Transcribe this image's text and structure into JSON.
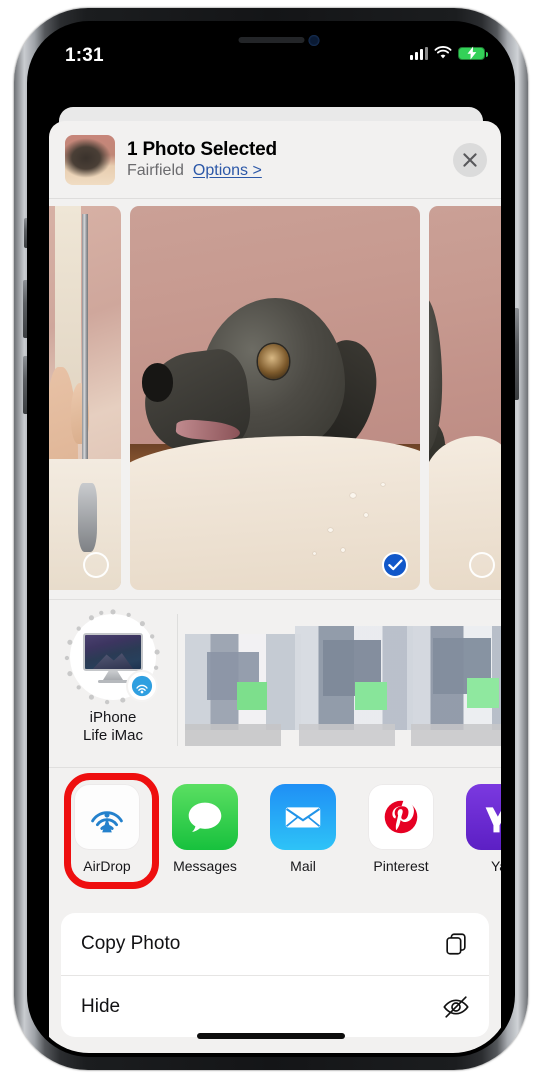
{
  "status_bar": {
    "time": "1:31",
    "signal_icon": "cellular-bars-icon",
    "wifi_icon": "wifi-icon",
    "battery_icon": "battery-charging-icon",
    "battery_color": "#33d158"
  },
  "share_sheet": {
    "header": {
      "thumbnail_name": "selected-photo-thumbnail",
      "title": "1 Photo Selected",
      "album": "Fairfield",
      "options_label": "Options >",
      "options_color": "#2c58a8",
      "close_icon": "close-icon"
    },
    "photos": [
      {
        "name": "photo-previous",
        "selected": false,
        "badge": "unselected-circle-icon"
      },
      {
        "name": "photo-current",
        "selected": true,
        "badge": "checkmark-circle-icon"
      },
      {
        "name": "photo-next",
        "selected": false,
        "badge": "unselected-circle-icon"
      }
    ],
    "selected_badge_color": "#1157c9",
    "airdrop": {
      "devices": [
        {
          "name": "iphone-life-imac",
          "label_line1": "iPhone",
          "label_line2": "Life iMac",
          "icon": "imac-icon",
          "badge_icon": "airdrop-badge-icon"
        }
      ],
      "blurred_suggestions_count": 4,
      "blurred_note": "pixelated contact suggestions"
    },
    "apps": [
      {
        "name": "airdrop",
        "label": "AirDrop",
        "icon": "airdrop-icon",
        "highlighted": true
      },
      {
        "name": "messages",
        "label": "Messages",
        "icon": "messages-icon",
        "highlighted": false
      },
      {
        "name": "mail",
        "label": "Mail",
        "icon": "mail-icon",
        "highlighted": false
      },
      {
        "name": "pinterest",
        "label": "Pinterest",
        "icon": "pinterest-icon",
        "highlighted": false
      },
      {
        "name": "yahoo",
        "label": "Ya",
        "icon": "yahoo-icon",
        "highlighted": false
      }
    ],
    "highlight_color": "#ee0f0f",
    "actions": [
      {
        "name": "copy-photo",
        "label": "Copy Photo",
        "icon": "copy-icon"
      },
      {
        "name": "hide",
        "label": "Hide",
        "icon": "eye-slash-icon"
      }
    ]
  }
}
